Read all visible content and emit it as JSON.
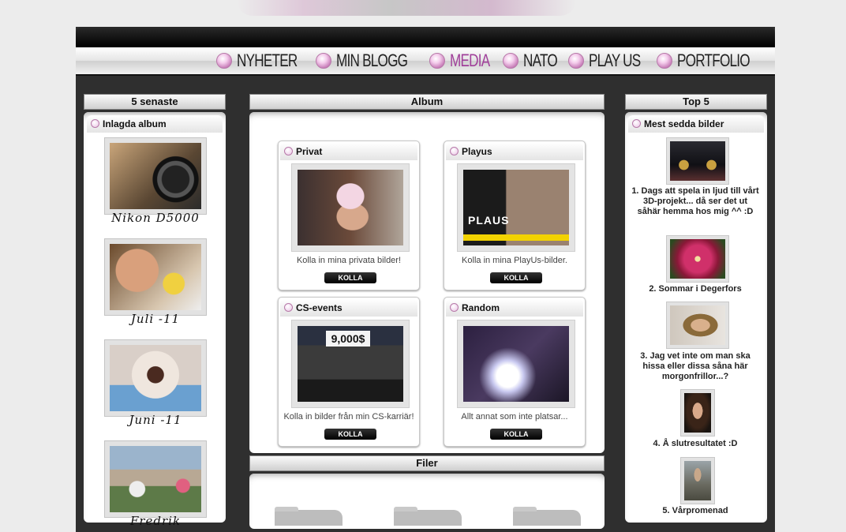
{
  "nav": {
    "items": [
      {
        "label": "NYHETER"
      },
      {
        "label": "MIN BLOGG"
      },
      {
        "label": "MEDIA"
      },
      {
        "label": "NATO"
      },
      {
        "label": "PLAY US"
      },
      {
        "label": "PORTFOLIO"
      }
    ],
    "active": "MEDIA"
  },
  "left": {
    "header": "5 senaste",
    "subheader": "Inlagda album",
    "items": [
      {
        "caption": "Nikon D5000"
      },
      {
        "caption": "Juli -11"
      },
      {
        "caption": "Juni -11"
      },
      {
        "caption": "Fredrik"
      }
    ]
  },
  "album": {
    "header": "Album",
    "boxes": [
      {
        "title": "Privat",
        "desc": "Kolla in mina privata bilder!",
        "button": "KOLLA"
      },
      {
        "title": "Playus",
        "desc": "Kolla in mina PlayUs-bilder.",
        "button": "KOLLA"
      },
      {
        "title": "CS-events",
        "desc": "Kolla in bilder från min CS-karriär!",
        "button": "KOLLA"
      },
      {
        "title": "Random",
        "desc": "Allt annat som inte platsar...",
        "button": "KOLLA"
      }
    ],
    "playus_logo": "PLAUS",
    "cs_banner": "9,000$"
  },
  "filer": {
    "header": "Filer"
  },
  "right": {
    "header": "Top 5",
    "subheader": "Mest sedda bilder",
    "items": [
      {
        "caption": "1. Dags att spela in ljud till vårt 3D-projekt... då ser det ut såhär hemma hos mig ^^ :D"
      },
      {
        "caption": "2. Sommar i Degerfors"
      },
      {
        "caption": "3. Jag vet inte om man ska hissa eller dissa såna här morgonfrillor...?"
      },
      {
        "caption": "4. Å slutresultatet :D"
      },
      {
        "caption": "5. Vårpromenad"
      }
    ]
  },
  "colors": {
    "accent": "#a0409a",
    "bg": "#2f2f2f",
    "button": "#000000"
  }
}
